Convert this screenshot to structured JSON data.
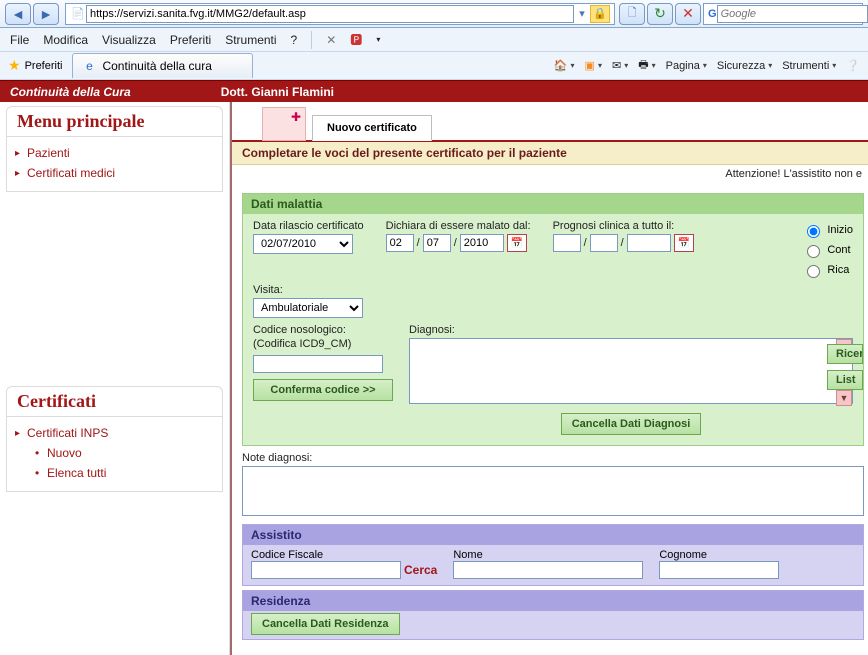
{
  "browser": {
    "url": "https://servizi.sanita.fvg.it/MMG2/default.asp",
    "search_placeholder": "Google",
    "menus": {
      "file": "File",
      "modifica": "Modifica",
      "visualizza": "Visualizza",
      "preferiti": "Preferiti",
      "strumenti": "Strumenti",
      "help": "?"
    },
    "fav_label": "Preferiti",
    "tab_title": "Continuità della cura",
    "cmds": {
      "pagina": "Pagina",
      "sicurezza": "Sicurezza",
      "strumenti": "Strumenti"
    }
  },
  "app": {
    "title": "Continuità della Cura",
    "user": "Dott. Gianni Flamini"
  },
  "left": {
    "main_title": "Menu principale",
    "main_items": {
      "pazienti": "Pazienti",
      "cert_medici": "Certificati medici"
    },
    "cert_title": "Certificati",
    "cert_items": {
      "inps": "Certificati INPS",
      "nuovo": "Nuovo",
      "elenca": "Elenca tutti"
    }
  },
  "content": {
    "tab_label": "Nuovo certificato",
    "instruction": "Completare le voci del presente certificato per il paziente",
    "warning": "Attenzione! L'assistito non e"
  },
  "malattia": {
    "header": "Dati malattia",
    "data_rilascio_label": "Data rilascio certificato",
    "data_rilascio_value": "02/07/2010",
    "dichiara_label": "Dichiara di essere malato dal:",
    "dichiara_d": "02",
    "dichiara_m": "07",
    "dichiara_y": "2010",
    "prognosi_label": "Prognosi clinica a tutto il:",
    "prognosi_d": "",
    "prognosi_m": "",
    "prognosi_y": "",
    "radio": {
      "inizio": "Inizio",
      "cont": "Cont",
      "rica": "Rica"
    },
    "visita_label": "Visita:",
    "visita_value": "Ambulatoriale",
    "codice_label1": "Codice nosologico:",
    "codice_label2": "(Codifica ICD9_CM)",
    "conferma_btn": "Conferma codice >>",
    "diagnosi_label": "Diagnosi:",
    "cancella_diag_btn": "Cancella Dati Diagnosi",
    "note_label": "Note diagnosi:",
    "side_btn1": "Ricer",
    "side_btn2": "List"
  },
  "assistito": {
    "header": "Assistito",
    "cf_label": "Codice Fiscale",
    "cerca": "Cerca",
    "nome_label": "Nome",
    "cognome_label": "Cognome"
  },
  "residenza": {
    "header": "Residenza",
    "cancella_btn": "Cancella Dati Residenza"
  }
}
